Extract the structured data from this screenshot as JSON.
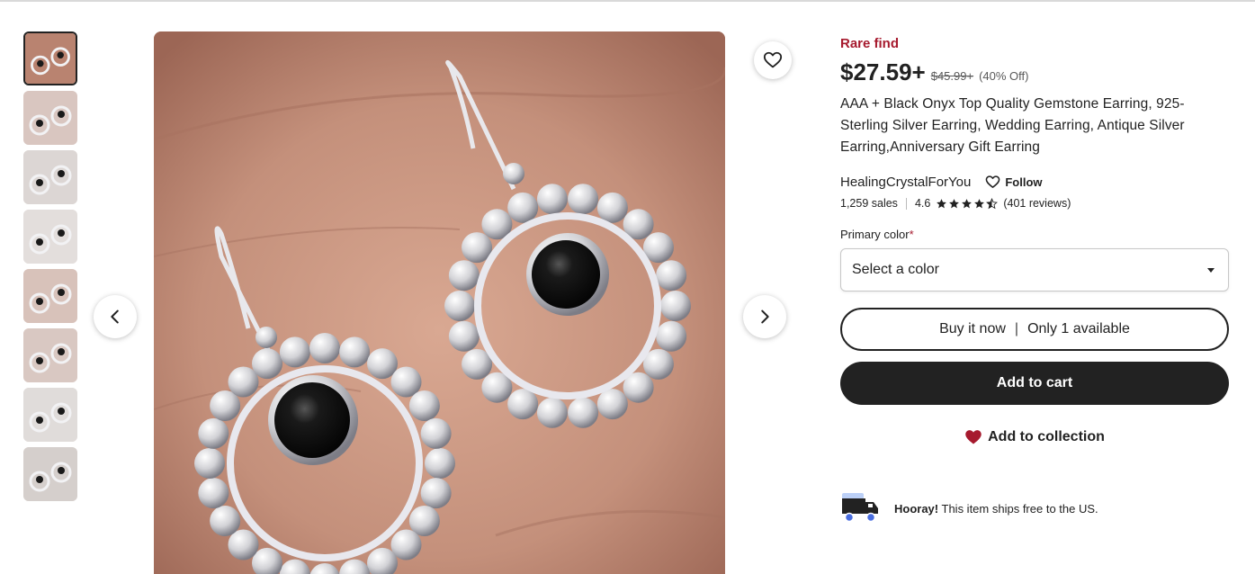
{
  "gallery": {
    "thumbnail_count": 8,
    "active_index": 0
  },
  "product": {
    "badge": "Rare find",
    "price": "$27.59+",
    "original_price": "$45.99+",
    "discount": "(40% Off)",
    "title": "AAA + Black Onyx Top Quality Gemstone Earring, 925-Sterling Silver Earring, Wedding Earring, Antique Silver Earring,Anniversary Gift Earring"
  },
  "seller": {
    "name": "HealingCrystalForYou",
    "follow_label": "Follow",
    "sales": "1,259 sales",
    "rating": "4.6",
    "rating_value": 4.6,
    "reviews": "(401 reviews)"
  },
  "options": {
    "label": "Primary color",
    "required_mark": "*",
    "select_value": "Select a color"
  },
  "actions": {
    "buy_now_label": "Buy it now",
    "buy_now_separator": "|",
    "availability": "Only 1 available",
    "add_to_cart_label": "Add to cart",
    "add_to_collection_label": "Add to collection"
  },
  "shipping": {
    "highlight": "Hooray!",
    "message": "This item ships free to the US."
  },
  "colors": {
    "accent": "#a61a2e",
    "button_dark": "#222222",
    "heart": "#a61a2e",
    "truck_blue": "#4a6ee0"
  },
  "icons": {
    "favorite": "heart-outline-icon",
    "prev": "chevron-left-icon",
    "next": "chevron-right-icon",
    "follow": "heart-outline-icon",
    "dropdown": "caret-down-icon",
    "collection": "heart-filled-icon",
    "shipping": "truck-icon"
  }
}
